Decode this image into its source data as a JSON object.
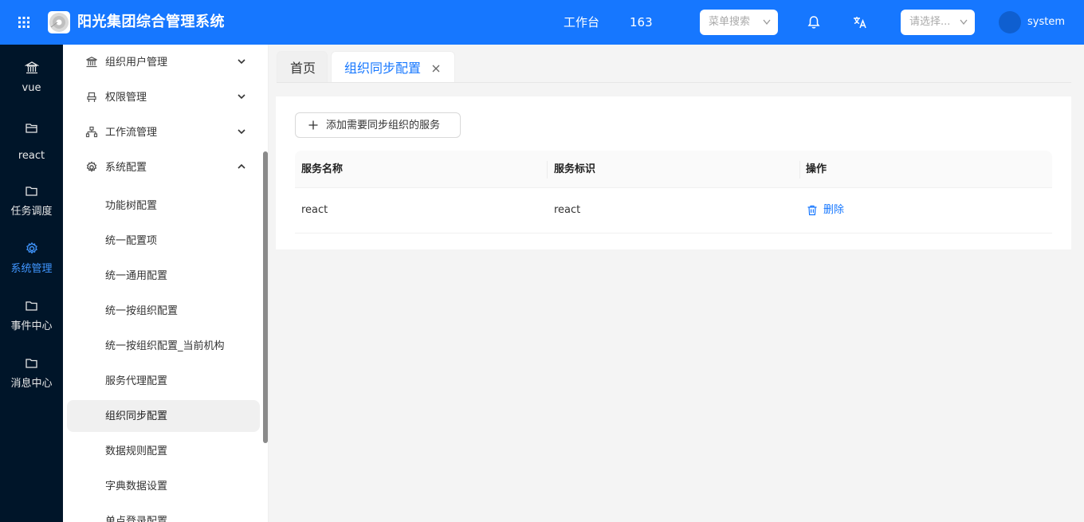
{
  "header": {
    "app_title": "阳光集团综合管理系统",
    "links": [
      "工作台",
      "163"
    ],
    "menu_search_placeholder": "菜单搜索",
    "org_select_placeholder": "请选择...",
    "user_name": "system",
    "brand_color": "#1677ff"
  },
  "rail": {
    "items": [
      {
        "label": "vue",
        "icon": "bank-icon"
      },
      {
        "label": "react",
        "icon": "folder-open-icon"
      },
      {
        "label": "任务调度",
        "icon": "folder-icon"
      },
      {
        "label": "系统管理",
        "icon": "gear-icon",
        "active": true
      },
      {
        "label": "事件中心",
        "icon": "folder-icon"
      },
      {
        "label": "消息中心",
        "icon": "folder-icon"
      }
    ]
  },
  "submenu": {
    "groups": [
      {
        "label": "组织用户管理",
        "icon": "bank-icon",
        "expanded": false
      },
      {
        "label": "权限管理",
        "icon": "seat-icon",
        "expanded": false
      },
      {
        "label": "工作流管理",
        "icon": "cluster-icon",
        "expanded": false
      },
      {
        "label": "系统配置",
        "icon": "gear-icon",
        "expanded": true
      }
    ],
    "items": [
      "功能树配置",
      "统一配置项",
      "统一通用配置",
      "统一按组织配置",
      "统一按组织配置_当前机构",
      "服务代理配置",
      "组织同步配置",
      "数据规则配置",
      "字典数据设置",
      "单点登录配置"
    ],
    "selected": "组织同步配置"
  },
  "tabs": {
    "home": "首页",
    "active": "组织同步配置"
  },
  "content": {
    "add_button_label": "添加需要同步组织的服务",
    "table": {
      "columns": [
        "服务名称",
        "服务标识",
        "操作"
      ],
      "rows": [
        {
          "name": "react",
          "identifier": "react",
          "action": "删除"
        }
      ]
    }
  }
}
